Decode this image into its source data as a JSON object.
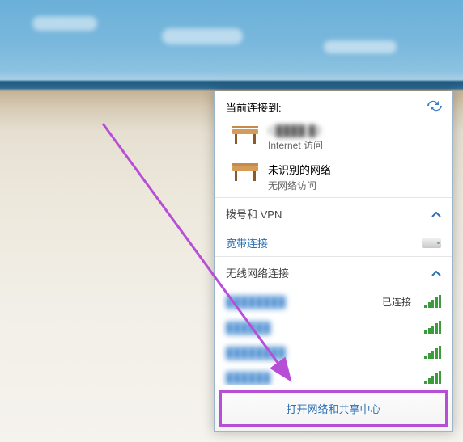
{
  "header": {
    "title": "当前连接到:"
  },
  "connections": [
    {
      "name": "C████ █2",
      "sub": "Internet 访问"
    },
    {
      "name": "未识别的网络",
      "sub": "无网络访问"
    }
  ],
  "dialup": {
    "title": "拨号和 VPN",
    "item": "宽带连接"
  },
  "wifi_section": {
    "title": "无线网络连接",
    "connected_label": "已连接",
    "items": [
      {
        "name": "████████",
        "connected": true,
        "strength": 5
      },
      {
        "name": "██████",
        "connected": false,
        "strength": 5
      },
      {
        "name": "████████",
        "connected": false,
        "strength": 5
      },
      {
        "name": "██████",
        "connected": false,
        "strength": 5
      }
    ]
  },
  "footer": {
    "open_center": "打开网络和共享中心"
  },
  "annotation": {
    "arrow_color": "#b74fd6"
  }
}
